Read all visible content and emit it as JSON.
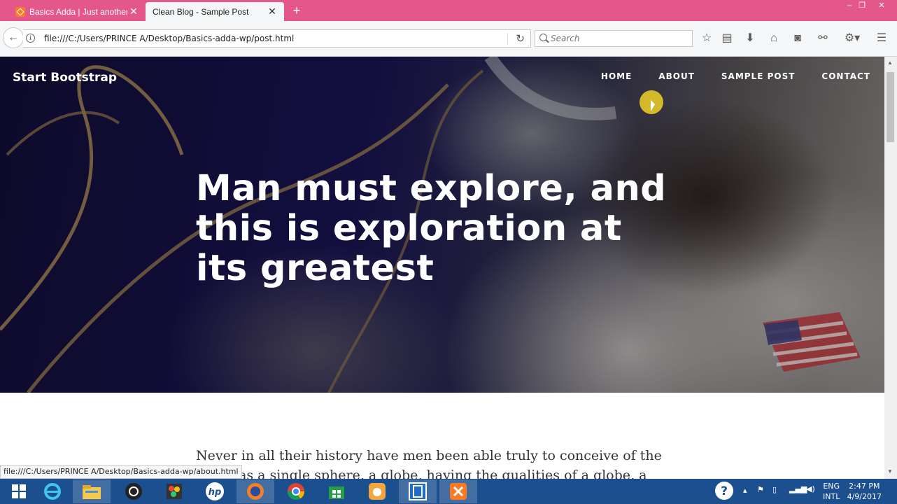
{
  "browser": {
    "tabs": [
      {
        "title": "Basics Adda | Just another W",
        "active": false
      },
      {
        "title": "Clean Blog - Sample Post",
        "active": true
      }
    ],
    "url": "file:///C:/Users/PRINCE A/Desktop/Basics-adda-wp/post.html",
    "search_placeholder": "Search",
    "status_url": "file:///C:/Users/PRINCE A/Desktop/Basics-adda-wp/about.html",
    "tab_accent": "#e4578b"
  },
  "page": {
    "brand": "Start Bootstrap",
    "nav": [
      "HOME",
      "ABOUT",
      "SAMPLE POST",
      "CONTACT"
    ],
    "headline": "Man must explore, and this is exploration at its greatest",
    "body_text": "Never in all their history have men been able truly to conceive of the world as a single sphere, a globe, having the qualities of a globe, a round earth in"
  },
  "taskbar": {
    "apps": [
      "windows-start",
      "internet-explorer",
      "file-explorer",
      "media-player",
      "paint",
      "hp",
      "firefox",
      "chrome",
      "store",
      "uc-browser",
      "app-blue",
      "xampp"
    ],
    "lang_line1": "ENG",
    "lang_line2": "INTL",
    "time": "2:47 PM",
    "date": "4/9/2017"
  }
}
